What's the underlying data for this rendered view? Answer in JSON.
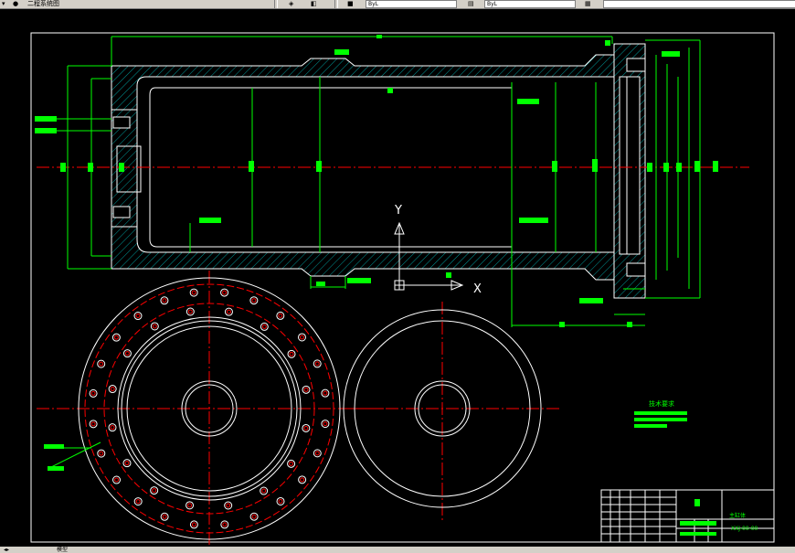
{
  "toolbar": {
    "partial_label": "二程系统图",
    "combo1": "ByL",
    "combo2": "ByL"
  },
  "drawing": {
    "axis_y": "Y",
    "axis_x": "X",
    "tech_requirements_title": "技术要求",
    "title_block_name": "主缸体",
    "title_block_number": "XXJ-00-00"
  },
  "statusbar": {
    "layout_tab": "模型"
  },
  "colors": {
    "background": "#000000",
    "outline": "#ffffff",
    "dimension": "#00ff00",
    "centerline": "#ff0000",
    "hatch": "#00ffff"
  }
}
